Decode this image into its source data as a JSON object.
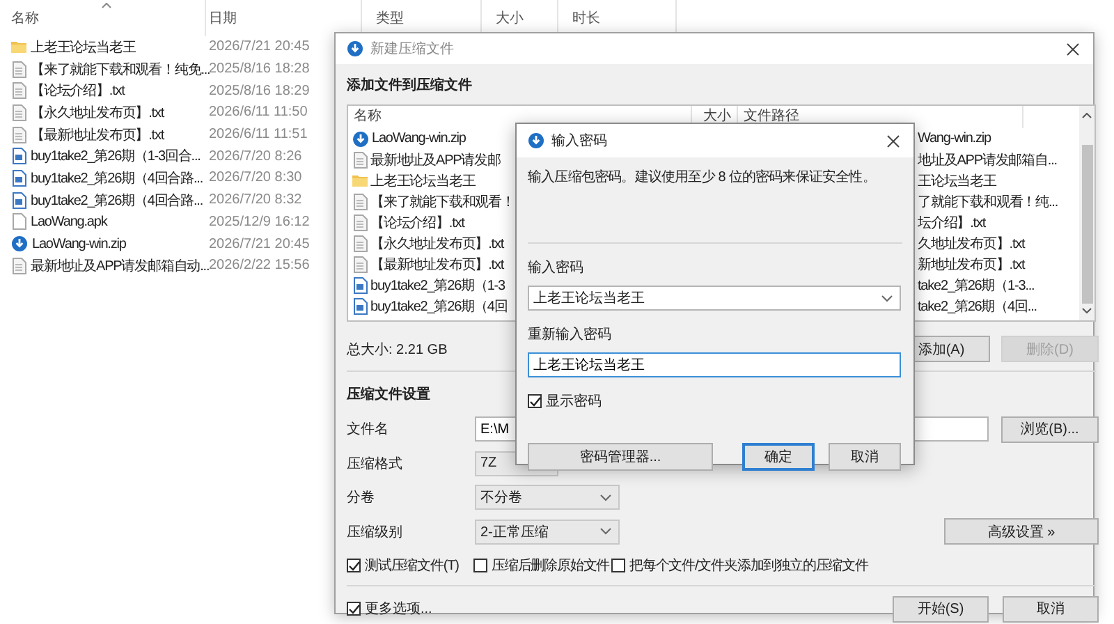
{
  "explorer": {
    "columns": [
      "名称",
      "日期",
      "类型",
      "大小",
      "时长"
    ],
    "files": [
      {
        "kind": "folder",
        "name": "上老王论坛当老王",
        "date": "2026/7/21 20:45"
      },
      {
        "kind": "text",
        "name": "【来了就能下载和观看！纯免...",
        "date": "2025/8/16 18:28"
      },
      {
        "kind": "text",
        "name": "【论坛介绍】.txt",
        "date": "2025/8/16 18:29"
      },
      {
        "kind": "text",
        "name": "【永久地址发布页】.txt",
        "date": "2026/6/11 11:50"
      },
      {
        "kind": "text",
        "name": "【最新地址发布页】.txt",
        "date": "2026/6/11 11:51"
      },
      {
        "kind": "video",
        "name": "buy1take2_第26期（1-3回合...",
        "date": "2026/7/20 8:26"
      },
      {
        "kind": "video",
        "name": "buy1take2_第26期（4回合路...",
        "date": "2026/7/20 8:30"
      },
      {
        "kind": "video",
        "name": "buy1take2_第26期（4回合路...",
        "date": "2026/7/20 8:32"
      },
      {
        "kind": "apk",
        "name": "LaoWang.apk",
        "date": "2025/12/9 16:12"
      },
      {
        "kind": "zip",
        "name": "LaoWang-win.zip",
        "date": "2026/7/21 20:45"
      },
      {
        "kind": "text",
        "name": "最新地址及APP请发邮箱自动...",
        "date": "2026/2/22 15:56"
      }
    ]
  },
  "archive_window": {
    "title": "新建压缩文件",
    "files_heading": "添加文件到压缩文件",
    "list_columns": [
      "名称",
      "大小",
      "文件路径"
    ],
    "list_rows": [
      {
        "kind": "zip",
        "name": "LaoWang-win.zip",
        "path": "Wang-win.zip"
      },
      {
        "kind": "text",
        "name": "最新地址及APP请发邮",
        "path": "地址及APP请发邮箱自..."
      },
      {
        "kind": "folder",
        "name": "上老王论坛当老王",
        "path": "王论坛当老王"
      },
      {
        "kind": "text",
        "name": "【来了就能下载和观看！",
        "path": "了就能下载和观看！纯..."
      },
      {
        "kind": "text",
        "name": "【论坛介绍】.txt",
        "path": "坛介绍】.txt"
      },
      {
        "kind": "text",
        "name": "【永久地址发布页】.txt",
        "path": "久地址发布页】.txt"
      },
      {
        "kind": "text",
        "name": "【最新地址发布页】.txt",
        "path": "新地址发布页】.txt"
      },
      {
        "kind": "video",
        "name": "buy1take2_第26期（1-3",
        "path": "take2_第26期（1-3..."
      },
      {
        "kind": "video",
        "name": "buy1take2_第26期（4回",
        "path": "take2_第26期（4回..."
      }
    ],
    "total_size": "总大小: 2.21 GB",
    "list_buttons": [
      {
        "label": "添加(A)",
        "disabled": false
      },
      {
        "label": "删除(D)",
        "disabled": true
      }
    ],
    "settings_heading": "压缩文件设置",
    "filename": {
      "label": "文件名",
      "value": "E:\\M",
      "button": "浏览(B)..."
    },
    "format": {
      "label": "压缩格式",
      "value": "7Z"
    },
    "volumes": {
      "label": "分卷",
      "value": "不分卷"
    },
    "level": {
      "label": "压缩级别",
      "value": "2-正常压缩",
      "button": "高级设置 »"
    },
    "options": [
      {
        "label": "测试压缩文件(T)",
        "checked": true
      },
      {
        "label": "压缩后删除原始文件",
        "checked": false
      },
      {
        "label": "把每个文件/文件夹添加到独立的压缩文件",
        "checked": false
      }
    ],
    "more_options": {
      "label": "更多选项...",
      "checked": true
    },
    "buttons": [
      "开始(S)",
      "取消"
    ]
  },
  "password_dialog": {
    "title": "输入密码",
    "hint": "输入压缩包密码。建议使用至少 8 位的密码来保证安全性。",
    "password_label": "输入密码",
    "password": "上老王论坛当老王",
    "confirm_label": "重新输入密码",
    "confirm": "上老王论坛当老王",
    "show_password": {
      "label": "显示密码",
      "checked": true
    },
    "buttons": [
      {
        "label": "密码管理器...",
        "default": false
      },
      {
        "label": "确定",
        "default": true
      },
      {
        "label": "取消",
        "default": false
      }
    ]
  }
}
